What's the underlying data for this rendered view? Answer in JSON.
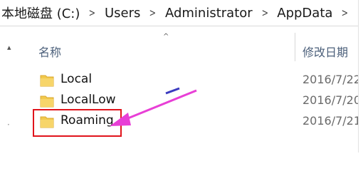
{
  "address_bar": {
    "segments": [
      "本地磁盘 (C:)",
      "Users",
      "Administrator",
      "AppData"
    ],
    "separator": ">"
  },
  "header": {
    "name_label": "名称",
    "date_label": "修改日期"
  },
  "files": [
    {
      "name": "Local",
      "date": "2016/7/22"
    },
    {
      "name": "LocalLow",
      "date": "2016/7/20"
    },
    {
      "name": "Roaming",
      "date": "2016/7/21"
    }
  ],
  "colors": {
    "highlight_box": "#e0141c",
    "annotation_arrow": "#e83fd6",
    "folder": "#f2c94c"
  }
}
